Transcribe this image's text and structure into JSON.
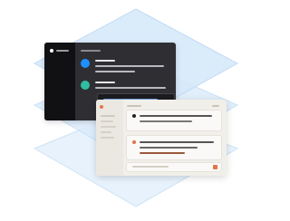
{
  "colors": {
    "layer_fill": "#dcecfb",
    "layer_stroke": "#c3ddf6",
    "dark_window": "#2f2f33",
    "dark_sidebar": "#111114",
    "avatar_blue": "#1e90ff",
    "avatar_teal": "#2fbfa0",
    "light_window": "#f1efe9",
    "accent_orange": "#e1744c",
    "accent_brown": "#9a5a3a"
  },
  "icons": {
    "dark_avatar_1": "avatar-icon",
    "dark_avatar_2": "avatar-icon",
    "light_avatar": "avatar-icon",
    "send": "send-icon"
  }
}
